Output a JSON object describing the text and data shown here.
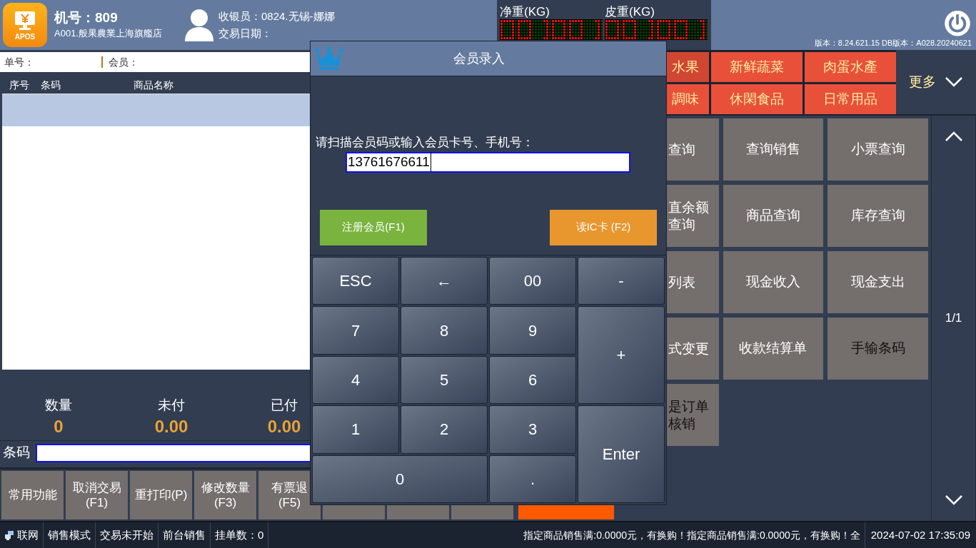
{
  "header": {
    "logo_text": "APOS",
    "machine": "机号：809",
    "store": "A001.般果農業上海旗艦店",
    "cashier": "收银员：0824.无锡-娜娜",
    "trade_date": "交易日期：",
    "net_weight_label": "净重(KG)",
    "tare_label": "皮重(KG)",
    "version": "版本：8.24.621.15 DB版本：A028.20240621"
  },
  "order_bar": {
    "order_label": "单号：",
    "member_label": "会员："
  },
  "table": {
    "columns": [
      "序号",
      "条码",
      "商品名称"
    ],
    "rows": [
      {
        "selected": true
      }
    ]
  },
  "summary": [
    {
      "label": "数量",
      "value": "0"
    },
    {
      "label": "未付",
      "value": "0.00"
    },
    {
      "label": "已付",
      "value": "0.00"
    }
  ],
  "barcode": {
    "label": "条码"
  },
  "function_keys": [
    {
      "kind": "gray",
      "label": "常用功能"
    },
    {
      "kind": "gray",
      "label": "取消交易",
      "key": "(F1)"
    },
    {
      "kind": "gray",
      "label": "重打印(P)"
    },
    {
      "kind": "gray",
      "label": "修改数量",
      "key": "(F3)"
    },
    {
      "kind": "gray",
      "label": "有票退",
      "key": "(F5)"
    },
    {
      "kind": "gray"
    },
    {
      "kind": "gray"
    },
    {
      "kind": "gray"
    },
    {
      "kind": "orange"
    }
  ],
  "categories": [
    {
      "label": "水果",
      "selected": true
    },
    {
      "label": "新鲜蔬菜",
      "selected": false
    },
    {
      "label": "肉蛋水產",
      "selected": false
    },
    {
      "label": "調味",
      "selected": false
    },
    {
      "label": "休閑食品",
      "selected": false
    },
    {
      "label": "日常用品",
      "selected": false
    }
  ],
  "more": "更多",
  "functions": [
    {
      "label": "查询",
      "kind": "light"
    },
    {
      "label": "查询销售",
      "kind": "light"
    },
    {
      "label": "小票查询",
      "kind": "light"
    },
    {
      "label": "直余额查询",
      "kind": "light"
    },
    {
      "label": "商品查询",
      "kind": "light"
    },
    {
      "label": "库存查询",
      "kind": "light"
    },
    {
      "label": "列表",
      "kind": "light"
    },
    {
      "label": "现金收入",
      "kind": "light"
    },
    {
      "label": "现金支出",
      "kind": "light"
    },
    {
      "label": "式变更",
      "kind": "light"
    },
    {
      "label": "收款结算单",
      "kind": "light"
    },
    {
      "label": "手输条码",
      "kind": "dark"
    },
    {
      "label": "是订单核销",
      "kind": "dark"
    }
  ],
  "page": "1/1",
  "status_bar": {
    "items": [
      "联网",
      "销售模式",
      "交易未开始",
      "前台销售",
      "挂单数：0"
    ],
    "ticker": "指定商品销售满:0.0000元，有换购！指定商品销售满:0.0000元，有换购！全",
    "datetime": "2024-07-02 17:35:09"
  },
  "dialog": {
    "title": "会员录入",
    "prompt": "请扫描会员码或输入会员卡号、手机号：",
    "value": "13761676611",
    "buttons": [
      {
        "label": "注册会员(F1)",
        "color": "#7ab33e"
      },
      {
        "label": "读IC卡 (F2)",
        "color": "#e8962e"
      }
    ],
    "keys": [
      {
        "label": "ESC",
        "kind": "normal"
      },
      {
        "label": "←",
        "kind": "normal"
      },
      {
        "label": "00",
        "kind": "normal"
      },
      {
        "label": "-",
        "kind": "normal"
      },
      {
        "label": "7",
        "kind": "normal"
      },
      {
        "label": "8",
        "kind": "normal"
      },
      {
        "label": "9",
        "kind": "normal"
      },
      {
        "label": "+",
        "kind": "tall"
      },
      {
        "label": "4",
        "kind": "normal"
      },
      {
        "label": "5",
        "kind": "normal"
      },
      {
        "label": "6",
        "kind": "normal"
      },
      {
        "label": "1",
        "kind": "normal"
      },
      {
        "label": "2",
        "kind": "normal"
      },
      {
        "label": "3",
        "kind": "normal"
      },
      {
        "label": "Enter",
        "kind": "tall"
      },
      {
        "label": "0",
        "kind": "wide"
      },
      {
        "label": ".",
        "kind": "normal"
      }
    ]
  }
}
